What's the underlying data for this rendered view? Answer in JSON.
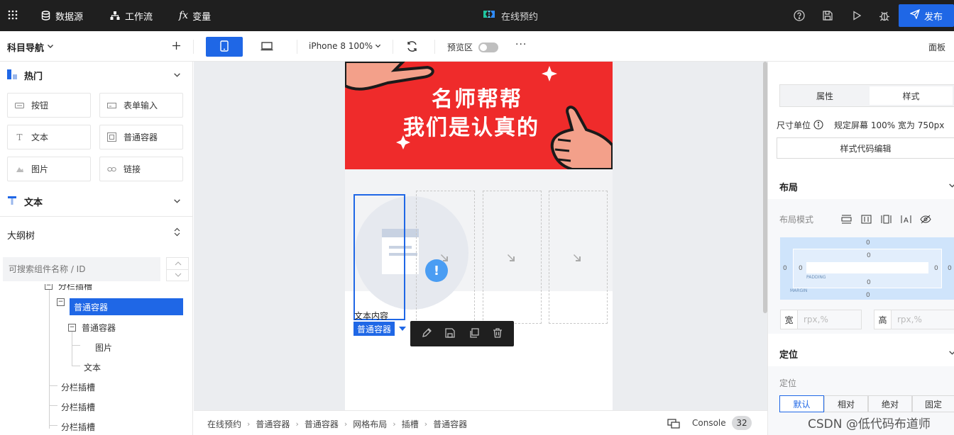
{
  "topbar": {
    "datasource": "数据源",
    "workflow": "工作流",
    "variables": "变量",
    "app_title": "在线预约",
    "publish": "发布"
  },
  "toolbar": {
    "nav_title": "科目导航",
    "device_label": "iPhone 8 100%",
    "preview_label": "预览区",
    "panel_label": "面板"
  },
  "left": {
    "hot_section": "热门",
    "components": [
      {
        "label": "按钮",
        "icon": "button-icon"
      },
      {
        "label": "表单输入",
        "icon": "input-icon"
      },
      {
        "label": "文本",
        "icon": "text-icon"
      },
      {
        "label": "普通容器",
        "icon": "container-icon"
      },
      {
        "label": "图片",
        "icon": "image-icon"
      },
      {
        "label": "链接",
        "icon": "link-icon"
      }
    ],
    "text_section": "文本",
    "outline_title": "大纲树",
    "search_placeholder": "可搜索组件名称 / ID",
    "tree": [
      {
        "label": "分栏插槽"
      },
      {
        "label": "普通容器"
      },
      {
        "label": "普通容器"
      },
      {
        "label": "图片"
      },
      {
        "label": "文本"
      },
      {
        "label": "分栏插槽"
      },
      {
        "label": "分栏插槽"
      },
      {
        "label": "分栏插槽"
      }
    ]
  },
  "canvas": {
    "banner_line1": "名师帮帮",
    "banner_line2": "我们是认真的",
    "text_content": "文本内容",
    "selected_label": "普通容器"
  },
  "bottom": {
    "breadcrumbs": [
      "在线预约",
      "普通容器",
      "普通容器",
      "网格布局",
      "插槽",
      "普通容器"
    ],
    "console": "Console",
    "console_count": "32"
  },
  "right": {
    "tab_props": "属性",
    "tab_style": "样式",
    "size_unit_label": "尺寸单位",
    "size_unit_value": "规定屏幕 100% 宽为 750px",
    "style_code_btn": "样式代码编辑",
    "layout_section": "布局",
    "layout_mode": "布局模式",
    "box": {
      "margin_top": "0",
      "margin_left": "0",
      "margin_right": "0",
      "margin_bottom": "0",
      "padding_top": "0",
      "padding_left": "0",
      "padding_right": "0",
      "padding_bottom": "0",
      "padding_tag": "PADDING",
      "margin_tag": "MARGIN"
    },
    "width_label": "宽",
    "height_label": "高",
    "unit_placeholder": "rpx,%",
    "position_section": "定位",
    "position_label": "定位",
    "position_options": [
      "默认",
      "相对",
      "绝对",
      "固定"
    ]
  },
  "watermark": "CSDN @低代码布道师",
  "colors": {
    "accent": "#1f67e6",
    "banner": "#ef2b2b",
    "topbar": "#1f1f1f"
  }
}
